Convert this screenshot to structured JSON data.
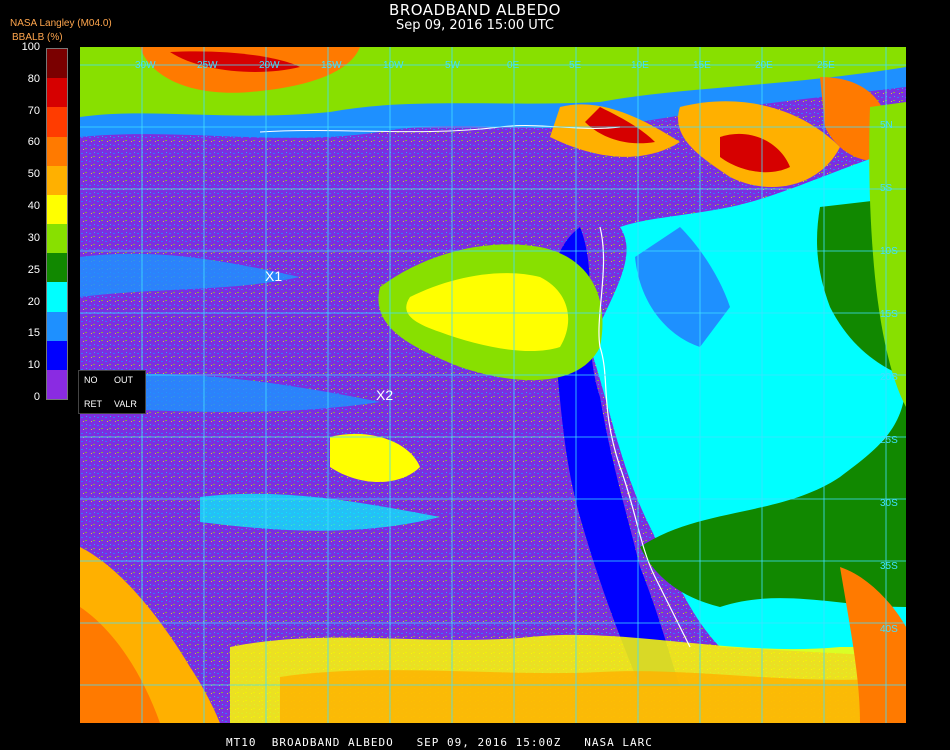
{
  "title": "BROADBAND ALBEDO",
  "timestamp": "Sep 09, 2016 15:00 UTC",
  "brand": "NASA Langley (M04.0)",
  "colorbar": {
    "label": "BBALB (%)",
    "ticks": [
      "100",
      "80",
      "70",
      "60",
      "50",
      "40",
      "30",
      "25",
      "20",
      "15",
      "10",
      "0"
    ],
    "colors": [
      "#7a0000",
      "#d60000",
      "#ff3c00",
      "#ff7a00",
      "#ffb000",
      "#ffff00",
      "#88e000",
      "#118800",
      "#00ffff",
      "#1e90ff",
      "#0000ff",
      "#8a2be2"
    ]
  },
  "legend": {
    "no": "NO",
    "out": "OUT",
    "ret": "RET",
    "valr": "VALR"
  },
  "markers": [
    {
      "label": "X1"
    },
    {
      "label": "X2"
    }
  ],
  "lat_labels": [
    "5N",
    "5S",
    "10S",
    "15S",
    "20S",
    "25S",
    "30S",
    "35S",
    "40S"
  ],
  "lon_labels": [
    "30W",
    "25W",
    "20W",
    "15W",
    "10W",
    "5W",
    "0E",
    "5E",
    "10E",
    "15E",
    "20E",
    "25E"
  ],
  "footer": "MT10  BROADBAND ALBEDO   SEP 09, 2016 15:00Z   NASA LARC"
}
